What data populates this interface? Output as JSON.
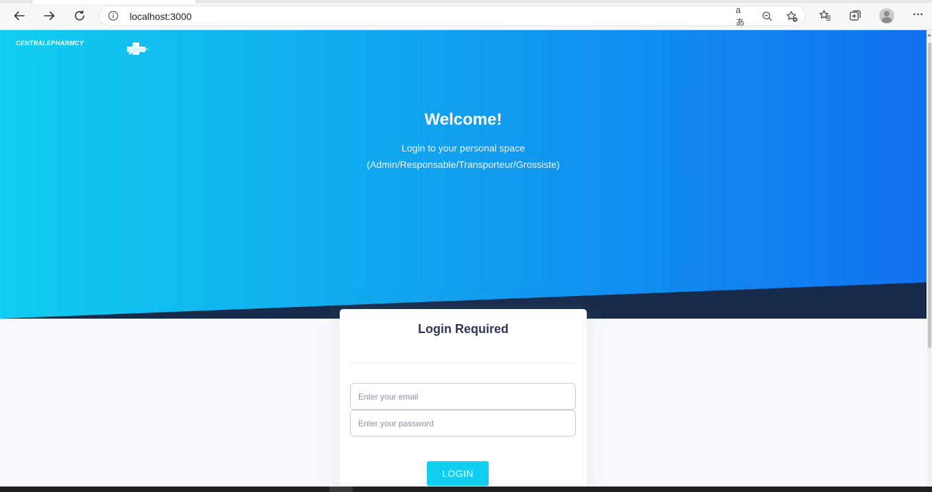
{
  "browser": {
    "url": "localhost:3000",
    "icons": [
      "back-icon",
      "forward-icon",
      "refresh-icon",
      "info-icon",
      "read-aloud-icon",
      "zoom-out-icon",
      "add-favorite-icon",
      "favorites-icon",
      "collections-icon",
      "profile-icon",
      "more-icon"
    ],
    "read_aloud_glyph": "aあ",
    "more_glyph": "···"
  },
  "hero": {
    "logo_text": "CENTRALEPHARMCY",
    "title": "Welcome!",
    "subtitle_line1": "Login to your personal space",
    "subtitle_line2": "(Admin/Responsable/Transporteur/Grossiste)",
    "gradient_start": "#11cdef",
    "gradient_end": "#1171ef",
    "wedge_color": "#172b4d"
  },
  "login": {
    "title": "Login Required",
    "email_placeholder": "Enter your email",
    "password_placeholder": "Enter your password",
    "button_label": "LOGIN",
    "button_color": "#11cdef"
  }
}
